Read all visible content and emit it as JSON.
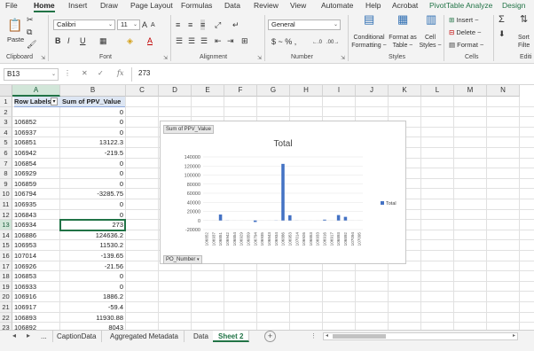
{
  "ribbon": {
    "tabs": [
      "File",
      "Home",
      "Insert",
      "Draw",
      "Page Layout",
      "Formulas",
      "Data",
      "Review",
      "View",
      "Automate",
      "Help",
      "Acrobat",
      "PivotTable Analyze",
      "Design"
    ],
    "active_tab": "Home",
    "paste_label": "Paste",
    "font_name": "Calibri",
    "font_size": "11",
    "number_format": "General",
    "number_symbols": "$ ~ % ,",
    "conditional_formatting": "Conditional Formatting ~",
    "format_as_table": "Format as Table ~",
    "cell_styles": "Cell Styles ~",
    "insert_label": "Insert ~",
    "delete_label": "Delete ~",
    "format_label": "Format ~",
    "sort_filter": "Sort Filte",
    "groups": {
      "clipboard": "Clipboard",
      "font": "Font",
      "alignment": "Alignment",
      "number": "Number",
      "styles": "Styles",
      "cells": "Cells",
      "editing": "Editi"
    },
    "accent_color": "#217346"
  },
  "formula_bar": {
    "name_box": "B13",
    "fx": "fx",
    "value": "273"
  },
  "grid": {
    "columns": [
      "A",
      "B",
      "C",
      "D",
      "E",
      "F",
      "G",
      "H",
      "I",
      "J",
      "K",
      "L",
      "M",
      "N"
    ],
    "selected_column": "A",
    "selected_row": "13",
    "rows": [
      {
        "num": "1",
        "a": "Row Labels",
        "b": "Sum of PPV_Value"
      },
      {
        "num": "2",
        "a": "",
        "b": "0"
      },
      {
        "num": "3",
        "a": "106852",
        "b": "0"
      },
      {
        "num": "4",
        "a": "106937",
        "b": "0"
      },
      {
        "num": "5",
        "a": "106851",
        "b": "13122.3"
      },
      {
        "num": "6",
        "a": "106942",
        "b": "-219.5"
      },
      {
        "num": "7",
        "a": "106854",
        "b": "0"
      },
      {
        "num": "8",
        "a": "106929",
        "b": "0"
      },
      {
        "num": "9",
        "a": "106859",
        "b": "0"
      },
      {
        "num": "10",
        "a": "106794",
        "b": "-3285.75"
      },
      {
        "num": "11",
        "a": "106935",
        "b": "0"
      },
      {
        "num": "12",
        "a": "106843",
        "b": "0"
      },
      {
        "num": "13",
        "a": "106934",
        "b": "273"
      },
      {
        "num": "14",
        "a": "106886",
        "b": "124636.2"
      },
      {
        "num": "15",
        "a": "106953",
        "b": "11530.2"
      },
      {
        "num": "16",
        "a": "107014",
        "b": "-139.65"
      },
      {
        "num": "17",
        "a": "106926",
        "b": "-21.56"
      },
      {
        "num": "18",
        "a": "106853",
        "b": "0"
      },
      {
        "num": "19",
        "a": "106933",
        "b": "0"
      },
      {
        "num": "20",
        "a": "106916",
        "b": "1886.2"
      },
      {
        "num": "21",
        "a": "106917",
        "b": "-59.4"
      },
      {
        "num": "22",
        "a": "106893",
        "b": "11930.88"
      },
      {
        "num": "23",
        "a": "106892",
        "b": "8043"
      }
    ]
  },
  "chart_data": {
    "type": "bar",
    "title": "Total",
    "field_button": "Sum of PPV_Value",
    "axis_field_button": "PO_Number",
    "legend": "Total",
    "legend_position": "right",
    "series_color": "#4472c4",
    "categories": [
      "106852",
      "106937",
      "106851",
      "106942",
      "106854",
      "106929",
      "106859",
      "106794",
      "106935",
      "106843",
      "106934",
      "106886",
      "106953",
      "107014",
      "106926",
      "106853",
      "106933",
      "106916",
      "106917",
      "106893",
      "106892",
      "107094",
      "107095"
    ],
    "values": [
      0,
      0,
      13122.3,
      -219.5,
      0,
      0,
      0,
      -3285.75,
      0,
      0,
      273,
      124636.2,
      11530.2,
      -139.65,
      -21.56,
      0,
      0,
      1886.2,
      -59.4,
      11930.88,
      8043,
      0,
      0
    ],
    "yticks": [
      "140000",
      "120000",
      "100000",
      "80000",
      "60000",
      "40000",
      "20000",
      "0",
      "-20000"
    ],
    "ylim": [
      -20000,
      140000
    ]
  },
  "sheets": {
    "ellipsis": "...",
    "tabs": [
      "CaptionData",
      "Aggregated Metadata",
      "Data",
      "Sheet 2"
    ],
    "active": "Sheet 2",
    "add": "+"
  }
}
